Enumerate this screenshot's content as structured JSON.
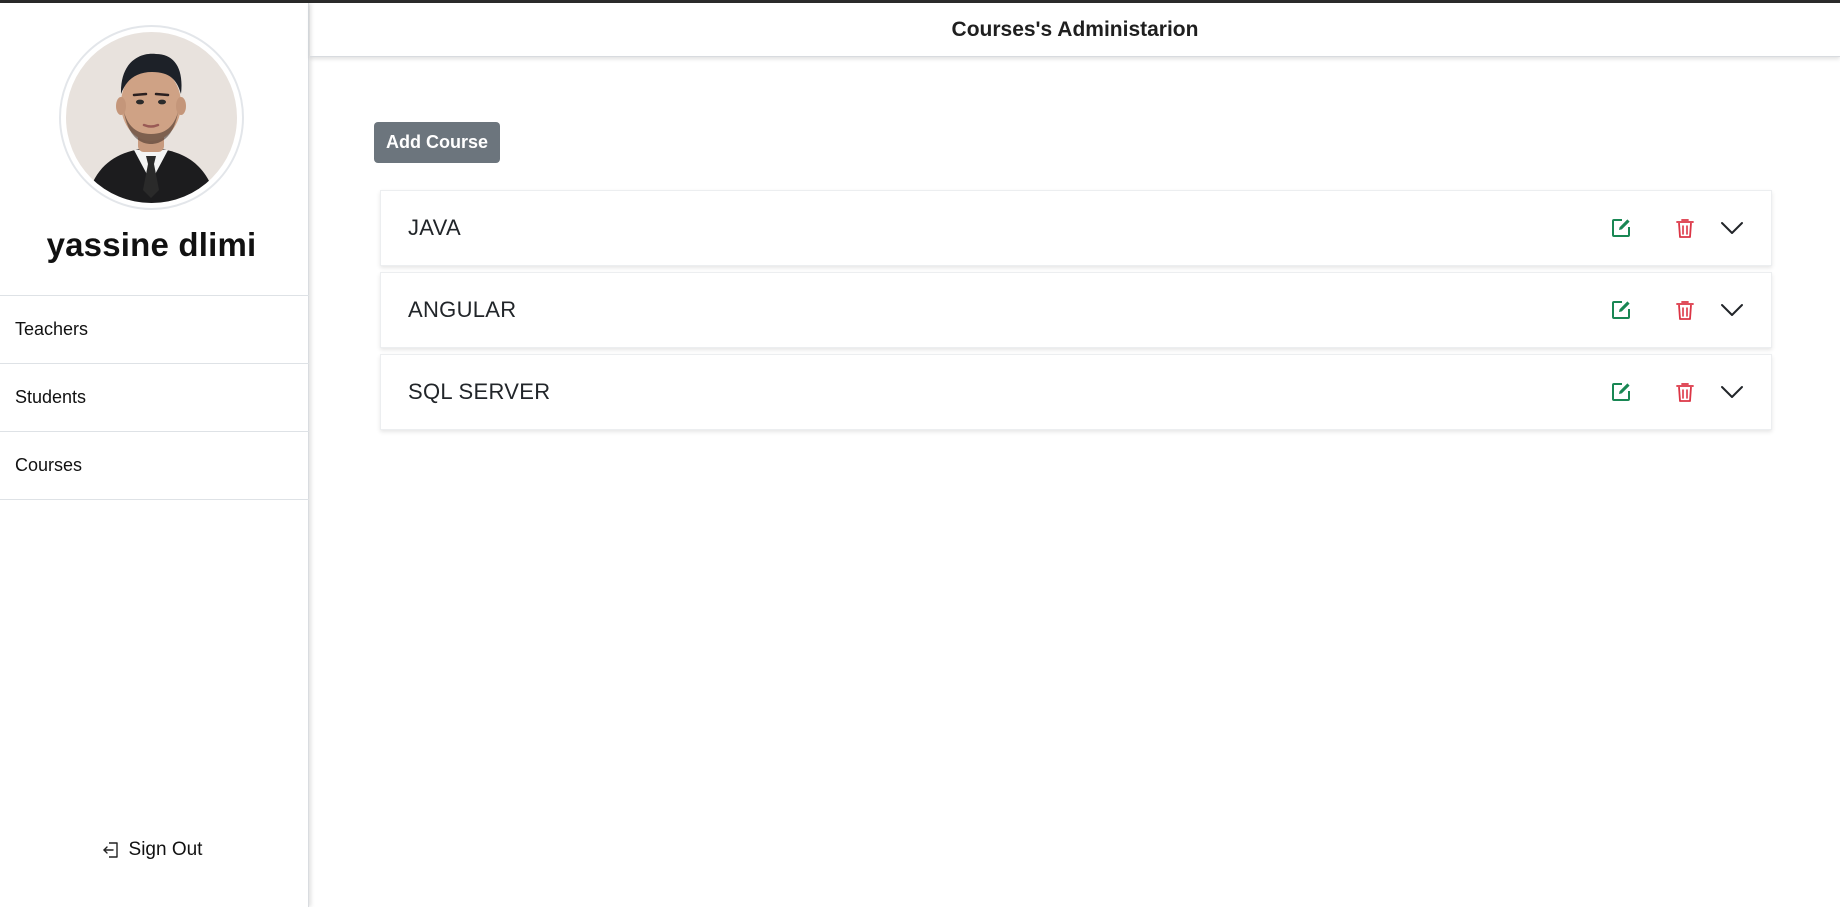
{
  "user": {
    "name": "yassine dlimi",
    "avatar_icon": "user-portrait"
  },
  "sidebar": {
    "items": [
      {
        "label": "Teachers"
      },
      {
        "label": "Students"
      },
      {
        "label": "Courses"
      }
    ],
    "signout": {
      "label": "Sign Out",
      "icon": "sign-out-icon"
    }
  },
  "header": {
    "title": "Courses's Administarion"
  },
  "main": {
    "add_label": "Add Course",
    "courses": [
      {
        "name": "JAVA"
      },
      {
        "name": "ANGULAR"
      },
      {
        "name": "SQL SERVER"
      }
    ],
    "icons": {
      "edit": "edit-icon",
      "delete": "trash-icon",
      "expand": "chevron-down-icon"
    }
  },
  "colors": {
    "edit": "#198754",
    "delete": "#dc3545",
    "button_bg": "#6c757d",
    "text": "#212529"
  }
}
